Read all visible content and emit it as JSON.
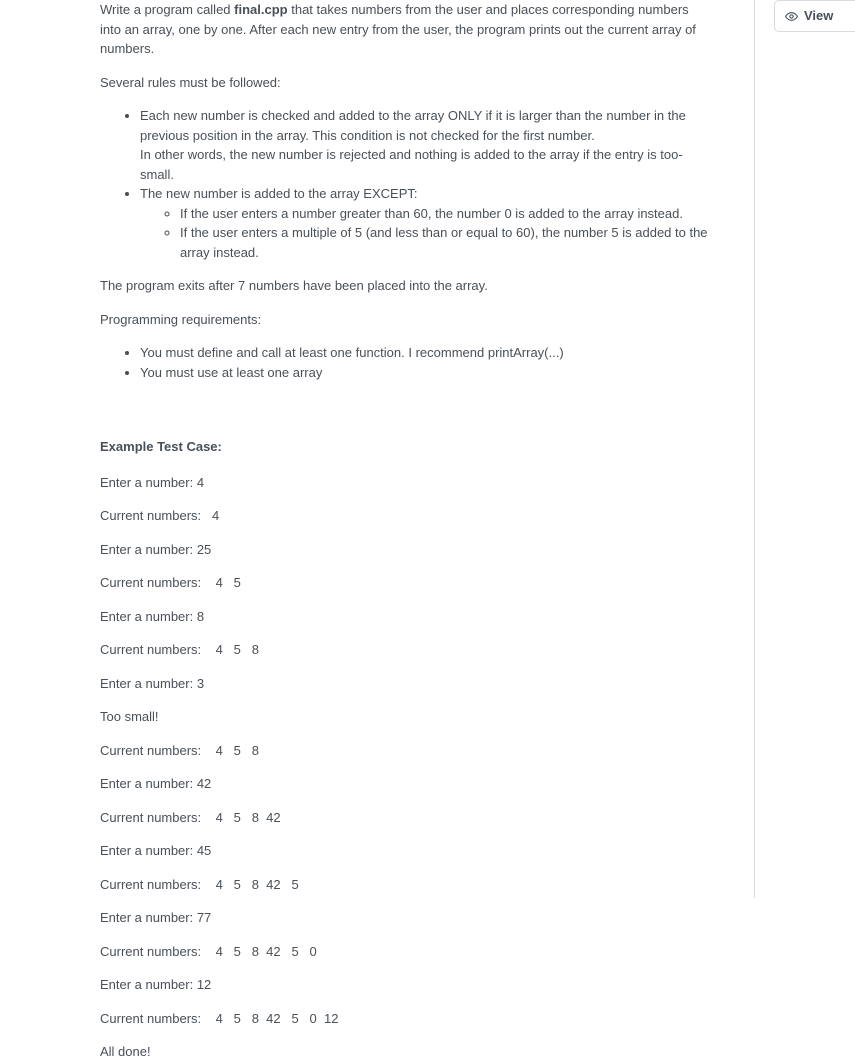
{
  "intro": {
    "p1_pre": " Write a program called ",
    "p1_bold": "final.cpp",
    "p1_post": " that takes numbers from the user and places corresponding numbers into an array, one by one. After each new entry from the user, the program prints out the current array of numbers.",
    "rules_intro": "Several rules must be followed:",
    "rule1_a": "Each new number is checked and added to the array ONLY if it is larger than the number in the previous position in the array. This condition is not checked for the first number.",
    "rule1_b": "In other words, the new number is rejected and nothing is added to the array if the entry is too-small.",
    "rule2": "The new number is added to the array EXCEPT:",
    "sub_a": "If the user enters a number greater than 60, the number 0 is added to the array instead.",
    "sub_b": "If the user enters a multiple of 5 (and less than or equal to 60), the number 5 is added to the array instead.",
    "exit": " The program exits after 7 numbers have been placed into the array.",
    "prog_req": " Programming requirements:",
    "req1": "You must define and call at least one function. I recommend printArray(...)",
    "req2": "You must use at least one array"
  },
  "test": {
    "title": "Example Test Case:",
    "lines": [
      "Enter a number: 4",
      "Current numbers:   4",
      "Enter a number: 25",
      "Current numbers:    4   5",
      "Enter a number: 8",
      "Current numbers:    4   5   8",
      "Enter a number: 3",
      "Too small!",
      "Current numbers:    4   5   8",
      "Enter a number: 42",
      "Current numbers:    4   5   8  42",
      "Enter a number: 45",
      "Current numbers:    4   5   8  42   5",
      "Enter a number: 77",
      "Current numbers:    4   5   8  42   5   0",
      "Enter a number: 12",
      "Current numbers:    4   5   8  42   5   0  12",
      "All done!"
    ]
  },
  "sidebar": {
    "view_label": "View"
  }
}
